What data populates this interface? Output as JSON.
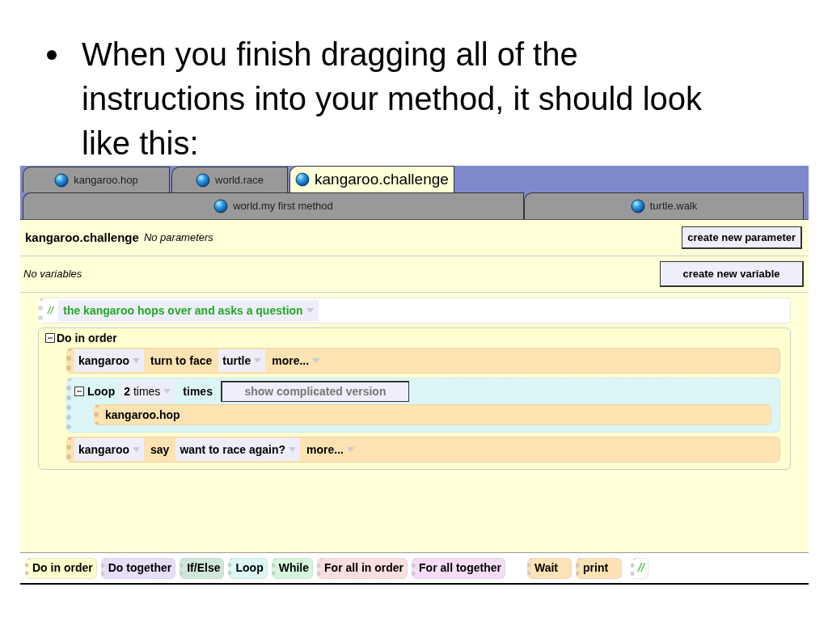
{
  "bullet": {
    "text": "When you finish dragging all of the instructions into your method, it should look like this:"
  },
  "tabs_row1": [
    {
      "label": "kangaroo.hop",
      "selected": false
    },
    {
      "label": "world.race",
      "selected": false
    },
    {
      "label": "kangaroo.challenge",
      "selected": true
    }
  ],
  "tabs_row2": [
    {
      "label": "world.my first method",
      "selected": false
    },
    {
      "label": "turtle.walk",
      "selected": false
    }
  ],
  "header": {
    "method_name": "kangaroo.challenge",
    "parameters": "No parameters",
    "button": "create new parameter"
  },
  "variables": {
    "text": "No variables",
    "button": "create new variable"
  },
  "comment": {
    "mark": "//",
    "text": "the kangaroo hops over and asks a question"
  },
  "do_in_order": {
    "label": "Do in order",
    "expanded": true,
    "children": [
      {
        "kind": "call",
        "tokens": [
          {
            "text": "kangaroo",
            "kind": "dropdown"
          },
          {
            "text": "turn to face",
            "kind": "text"
          },
          {
            "text": "turtle",
            "kind": "dropdown"
          },
          {
            "text": "more...",
            "kind": "menu"
          }
        ]
      },
      {
        "kind": "loop",
        "label": "Loop",
        "expanded": true,
        "count": "**2** times",
        "times": "times",
        "button": "show complicated version",
        "children": [
          {
            "kind": "call",
            "tokens": [
              {
                "text": "kangaroo.hop",
                "kind": "text"
              }
            ]
          }
        ]
      },
      {
        "kind": "call",
        "tokens": [
          {
            "text": "kangaroo",
            "kind": "dropdown"
          },
          {
            "text": "say",
            "kind": "text"
          },
          {
            "text": "want to race again?",
            "kind": "dropdown"
          },
          {
            "text": "more...",
            "kind": "menu"
          }
        ]
      }
    ]
  },
  "palette": [
    {
      "label": "Do in order",
      "kind": "control",
      "color": "#ffffcc"
    },
    {
      "label": "Do together",
      "kind": "control",
      "color": "#e8defa"
    },
    {
      "label": "If/Else",
      "kind": "control",
      "color": "#cfe8d8"
    },
    {
      "label": "Loop",
      "kind": "control",
      "color": "#ddf7f7"
    },
    {
      "label": "While",
      "kind": "control",
      "color": "#d5f7dc"
    },
    {
      "label": "For all in order",
      "kind": "control",
      "color": "#fbdede"
    },
    {
      "label": "For all together",
      "kind": "control",
      "color": "#f5ddf8"
    },
    {
      "label": "Wait",
      "kind": "action",
      "color": "#fde2b4"
    },
    {
      "label": "print",
      "kind": "action",
      "color": "#fde2b4"
    },
    {
      "label": "//",
      "kind": "comment",
      "color": "#ffffff"
    }
  ]
}
